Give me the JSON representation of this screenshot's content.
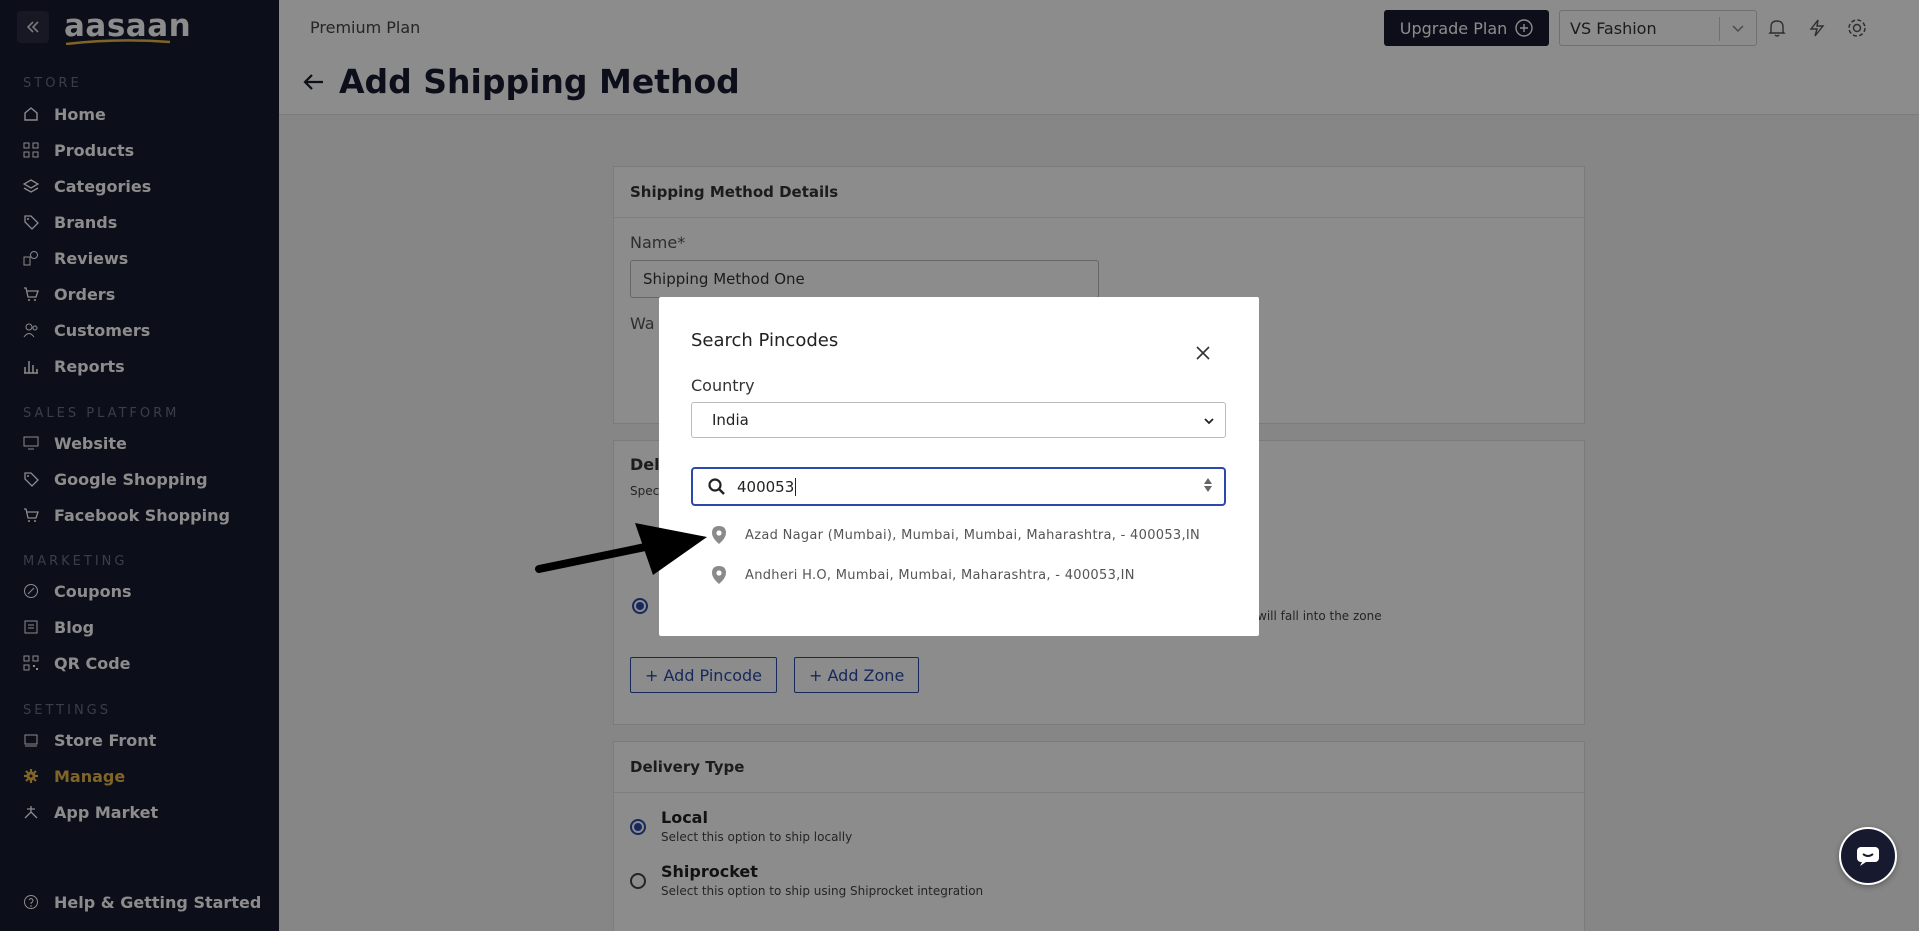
{
  "sidebar": {
    "logo": "aasaan",
    "sections": {
      "store": "STORE",
      "sales": "SALES PLATFORM",
      "marketing": "MARKETING",
      "settings": "SETTINGS"
    },
    "items": [
      {
        "label": "Home",
        "icon": "home-icon"
      },
      {
        "label": "Products",
        "icon": "grid-icon"
      },
      {
        "label": "Categories",
        "icon": "layers-icon"
      },
      {
        "label": "Brands",
        "icon": "tag-icon"
      },
      {
        "label": "Reviews",
        "icon": "reviews-icon"
      },
      {
        "label": "Orders",
        "icon": "cart-icon"
      },
      {
        "label": "Customers",
        "icon": "users-icon"
      },
      {
        "label": "Reports",
        "icon": "bar-chart-icon"
      },
      {
        "label": "Website",
        "icon": "monitor-icon"
      },
      {
        "label": "Google Shopping",
        "icon": "tag-icon"
      },
      {
        "label": "Facebook Shopping",
        "icon": "cart-icon"
      },
      {
        "label": "Coupons",
        "icon": "coupon-icon"
      },
      {
        "label": "Blog",
        "icon": "book-icon"
      },
      {
        "label": "QR Code",
        "icon": "qr-icon"
      },
      {
        "label": "Store Front",
        "icon": "store-icon"
      },
      {
        "label": "Manage",
        "icon": "gear-icon"
      },
      {
        "label": "App Market",
        "icon": "app-icon"
      },
      {
        "label": "Help & Getting Started",
        "icon": "help-icon"
      }
    ],
    "active_color": "#e9b84a"
  },
  "topbar": {
    "plan": "Premium Plan",
    "upgrade_label": "Upgrade Plan",
    "store_name": "VS Fashion"
  },
  "page": {
    "title": "Add Shipping Method"
  },
  "details_card": {
    "heading": "Shipping Method Details",
    "name_label": "Name*",
    "name_value": "Shipping Method One",
    "warehouse_label": "Wa"
  },
  "delivery_card": {
    "heading": "Deli",
    "sub": "Spec",
    "zone_hint": "will fall into the zone",
    "add_pincode": "+ Add Pincode",
    "add_zone": "+ Add Zone"
  },
  "delivery_type": {
    "heading": "Delivery Type",
    "options": [
      {
        "title": "Local",
        "sub": "Select this option to ship locally",
        "selected": true
      },
      {
        "title": "Shiprocket",
        "sub": "Select this option to ship using Shiprocket integration",
        "selected": false
      }
    ]
  },
  "modal": {
    "title": "Search Pincodes",
    "country_label": "Country",
    "country_value": "India",
    "search_value": "400053",
    "results": [
      "Azad Nagar (Mumbai), Mumbai, Mumbai, Maharashtra, - 400053,IN",
      "Andheri H.O, Mumbai, Mumbai, Maharashtra, - 400053,IN"
    ]
  },
  "colors": {
    "sidebar_bg": "#171a2e",
    "accent": "#2b4aa8",
    "brand_gold": "#e9b84a"
  }
}
